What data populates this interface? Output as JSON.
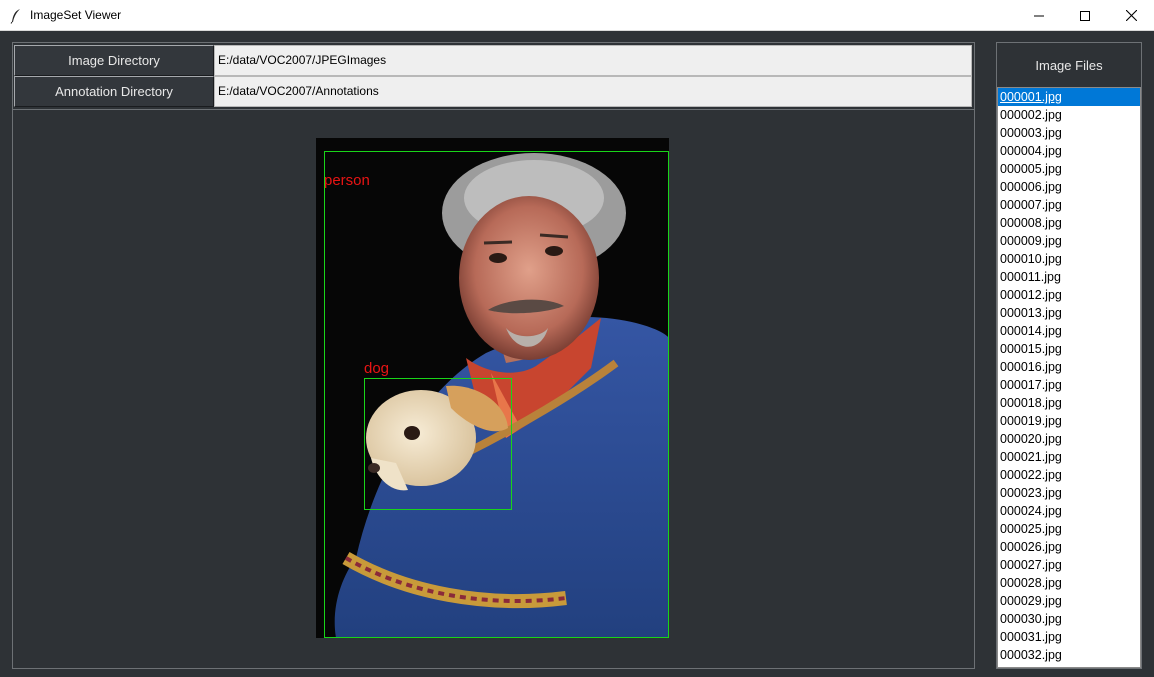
{
  "window": {
    "title": "ImageSet Viewer"
  },
  "controls": {
    "image_dir": {
      "label": "Image Directory",
      "value": "E:/data/VOC2007/JPEGImages"
    },
    "annotation_dir": {
      "label": "Annotation Directory",
      "value": "E:/data/VOC2007/Annotations"
    }
  },
  "annotations": [
    {
      "label": "person",
      "color": "#19d419",
      "label_color": "#e81414"
    },
    {
      "label": "dog",
      "color": "#19d419",
      "label_color": "#e81414"
    }
  ],
  "file_panel": {
    "title": "Image Files",
    "selected_index": 0,
    "files": [
      "000001.jpg",
      "000002.jpg",
      "000003.jpg",
      "000004.jpg",
      "000005.jpg",
      "000006.jpg",
      "000007.jpg",
      "000008.jpg",
      "000009.jpg",
      "000010.jpg",
      "000011.jpg",
      "000012.jpg",
      "000013.jpg",
      "000014.jpg",
      "000015.jpg",
      "000016.jpg",
      "000017.jpg",
      "000018.jpg",
      "000019.jpg",
      "000020.jpg",
      "000021.jpg",
      "000022.jpg",
      "000023.jpg",
      "000024.jpg",
      "000025.jpg",
      "000026.jpg",
      "000027.jpg",
      "000028.jpg",
      "000029.jpg",
      "000030.jpg",
      "000031.jpg",
      "000032.jpg"
    ]
  },
  "colors": {
    "background": "#2e3236",
    "selection": "#0078d7",
    "bbox": "#19d419",
    "label": "#e81414"
  }
}
